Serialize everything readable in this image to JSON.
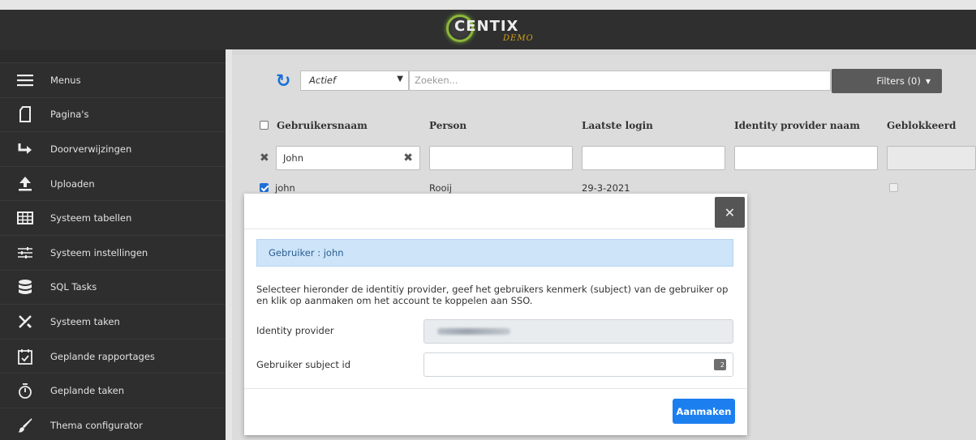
{
  "header": {
    "logo_text": "CENTIX",
    "logo_sub": "DEMO"
  },
  "sidebar": {
    "items": [
      {
        "label": "Menus",
        "icon": "hamburger-icon"
      },
      {
        "label": "Pagina's",
        "icon": "page-icon"
      },
      {
        "label": "Doorverwijzingen",
        "icon": "redirect-arrow-icon"
      },
      {
        "label": "Uploaden",
        "icon": "upload-icon"
      },
      {
        "label": "Systeem tabellen",
        "icon": "table-icon"
      },
      {
        "label": "Systeem instellingen",
        "icon": "sliders-icon"
      },
      {
        "label": "SQL Tasks",
        "icon": "database-icon"
      },
      {
        "label": "Systeem taken",
        "icon": "tools-icon"
      },
      {
        "label": "Geplande rapportages",
        "icon": "calendar-check-icon"
      },
      {
        "label": "Geplande taken",
        "icon": "stopwatch-icon"
      },
      {
        "label": "Thema configurator",
        "icon": "brush-icon"
      }
    ]
  },
  "toolbar": {
    "status_value": "Actief",
    "search_placeholder": "Zoeken...",
    "filters_label": "Filters (0)"
  },
  "table": {
    "columns": [
      "Gebruikersnaam",
      "Person",
      "Laatste login",
      "Identity provider naam",
      "Geblokkeerd"
    ],
    "filter_username": "John",
    "rows": [
      {
        "username": "john",
        "person": "Rooij",
        "last_login": "29-3-2021",
        "idp_name": "",
        "blocked": false,
        "selected": true
      }
    ]
  },
  "modal": {
    "info": "Gebruiker : john",
    "description": "Selecteer hieronder de identitiy provider, geef het gebruikers kenmerk (subject) van de gebruiker op en klik op aanmaken om het account te koppelen aan SSO.",
    "idp_label": "Identity provider",
    "subject_label": "Gebruiker subject id",
    "subject_value": "",
    "create_label": "Aanmaken"
  },
  "colors": {
    "accent": "#1c7ff0",
    "sidebar_bg": "#2e2e2e",
    "info_bg": "#cde4f9"
  }
}
